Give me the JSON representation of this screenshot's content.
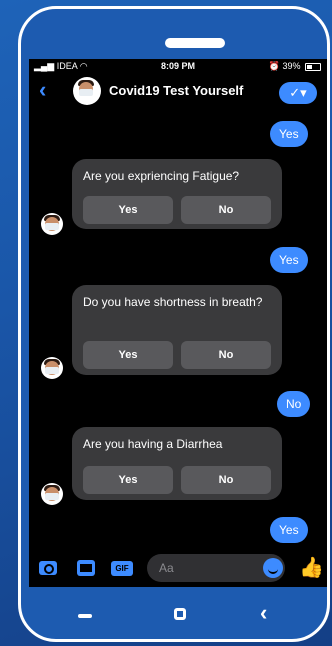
{
  "status": {
    "carrier": "IDEA",
    "time": "8:09 PM",
    "battery": "39%"
  },
  "header": {
    "title": "Covid19 Test Yourself",
    "check_label": "✓▾"
  },
  "messages": {
    "reply1": "Yes",
    "q1": {
      "text": "Are you expriencing Fatigue?",
      "yes": "Yes",
      "no": "No"
    },
    "reply2": "Yes",
    "q2": {
      "text": "Do you have shortness in breath?",
      "yes": "Yes",
      "no": "No"
    },
    "reply3": "No",
    "q3": {
      "text": "Are you having a Diarrhea",
      "yes": "Yes",
      "no": "No"
    },
    "reply4": "Yes"
  },
  "composer": {
    "placeholder": "Aa",
    "gif_label": "GIF"
  },
  "colors": {
    "accent": "#3d8bff",
    "card": "#3a3a3c",
    "button": "#59595c",
    "background": "#1d5bb0"
  }
}
